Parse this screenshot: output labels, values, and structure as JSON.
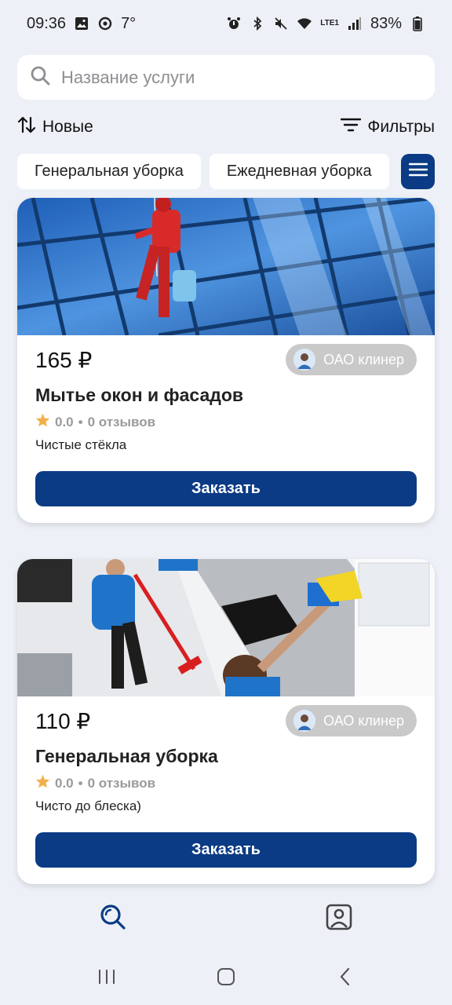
{
  "status": {
    "time": "09:36",
    "temperature": "7°",
    "network": "LTE1",
    "battery": "83%"
  },
  "search": {
    "placeholder": "Название услуги",
    "icon": "search-icon"
  },
  "toolbar": {
    "sort_label": "Новые",
    "filter_label": "Фильтры"
  },
  "categories": [
    {
      "label": "Генеральная уборка"
    },
    {
      "label": "Ежедневная уборка"
    }
  ],
  "services": [
    {
      "price": "165 ₽",
      "provider": "ОАО клинер",
      "title": "Мытье окон и фасадов",
      "rating": "0.0",
      "reviews": "0 отзывов",
      "description": "Чистые стёкла",
      "order_label": "Заказать"
    },
    {
      "price": "110 ₽",
      "provider": "ОАО клинер",
      "title": "Генеральная уборка",
      "rating": "0.0",
      "reviews": "0 отзывов",
      "description": "Чисто до блеска)",
      "order_label": "Заказать"
    }
  ],
  "colors": {
    "accent": "#0b3b84",
    "background": "#edf1f7",
    "star": "#f0b04b"
  }
}
